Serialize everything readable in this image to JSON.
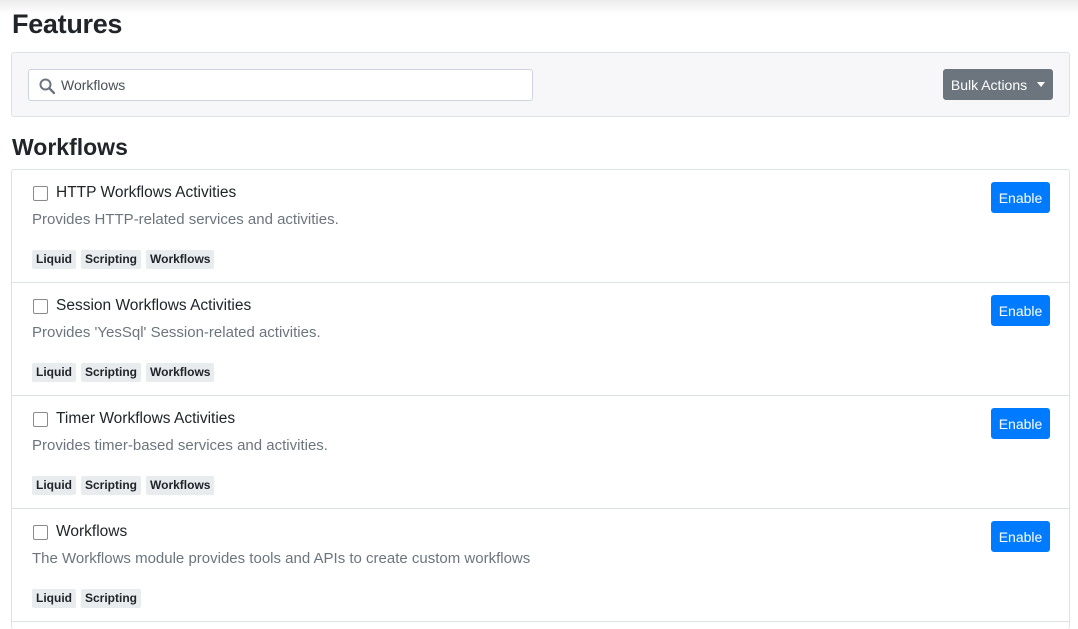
{
  "page": {
    "title": "Features"
  },
  "filter": {
    "search_value": "Workflows",
    "bulk_actions_label": "Bulk Actions"
  },
  "section": {
    "title": "Workflows"
  },
  "features": [
    {
      "name": "HTTP Workflows Activities",
      "description": "Provides HTTP-related services and activities.",
      "tags": [
        "Liquid",
        "Scripting",
        "Workflows"
      ],
      "action": "Enable"
    },
    {
      "name": "Session Workflows Activities",
      "description": "Provides 'YesSql' Session-related activities.",
      "tags": [
        "Liquid",
        "Scripting",
        "Workflows"
      ],
      "action": "Enable"
    },
    {
      "name": "Timer Workflows Activities",
      "description": "Provides timer-based services and activities.",
      "tags": [
        "Liquid",
        "Scripting",
        "Workflows"
      ],
      "action": "Enable"
    },
    {
      "name": "Workflows",
      "description": "The Workflows module provides tools and APIs to create custom workflows",
      "tags": [
        "Liquid",
        "Scripting"
      ],
      "action": "Enable"
    }
  ]
}
